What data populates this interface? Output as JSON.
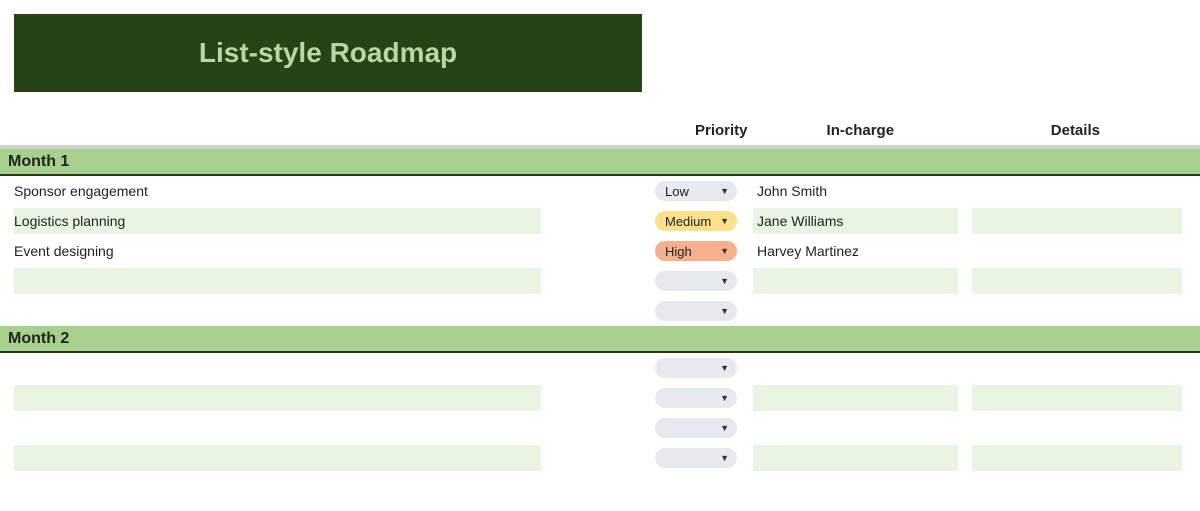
{
  "title": "List-style Roadmap",
  "columns": {
    "priority": "Priority",
    "incharge": "In-charge",
    "details": "Details"
  },
  "priority_labels": {
    "low": "Low",
    "medium": "Medium",
    "high": "High"
  },
  "groups": [
    {
      "label": "Month 1",
      "rows": [
        {
          "task": "Sponsor engagement",
          "priority": "low",
          "incharge": "John Smith",
          "details": "",
          "alt": false
        },
        {
          "task": "Logistics planning",
          "priority": "medium",
          "incharge": "Jane Williams",
          "details": "",
          "alt": true
        },
        {
          "task": "Event designing",
          "priority": "high",
          "incharge": "Harvey Martinez",
          "details": "",
          "alt": false
        },
        {
          "task": "",
          "priority": "",
          "incharge": "",
          "details": "",
          "alt": true
        },
        {
          "task": "",
          "priority": "",
          "incharge": "",
          "details": "",
          "alt": false,
          "task_blank": true,
          "side_blank": true
        }
      ]
    },
    {
      "label": "Month 2",
      "rows": [
        {
          "task": "",
          "priority": "",
          "incharge": "",
          "details": "",
          "alt": false,
          "task_blank": true,
          "side_blank": true
        },
        {
          "task": "",
          "priority": "",
          "incharge": "",
          "details": "",
          "alt": true
        },
        {
          "task": "",
          "priority": "",
          "incharge": "",
          "details": "",
          "alt": false,
          "task_blank": true,
          "side_blank": true
        },
        {
          "task": "",
          "priority": "",
          "incharge": "",
          "details": "",
          "alt": true
        }
      ]
    }
  ]
}
